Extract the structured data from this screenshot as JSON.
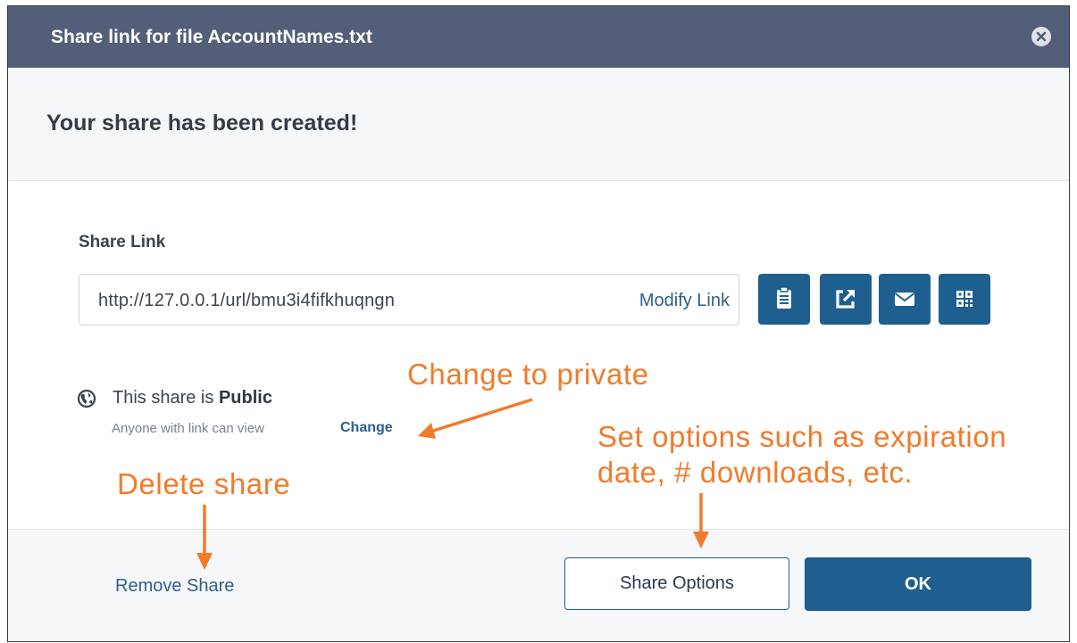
{
  "dialog": {
    "title": "Share link for file AccountNames.txt",
    "banner": "Your share has been created!"
  },
  "share": {
    "label": "Share Link",
    "url": "http://127.0.0.1/url/bmu3i4fifkhuqngn",
    "modify_label": "Modify Link",
    "icons": [
      "clipboard-icon",
      "external-link-icon",
      "email-icon",
      "qr-code-icon"
    ]
  },
  "visibility": {
    "prefix": "This share is",
    "status": "Public",
    "description": "Anyone with link can view",
    "change_label": "Change"
  },
  "footer": {
    "remove_label": "Remove Share",
    "options_label": "Share Options",
    "ok_label": "OK"
  },
  "annotations": {
    "private": "Change to private",
    "delete": "Delete share",
    "options_line1": "Set options such as expiration",
    "options_line2": "date, # downloads, etc."
  },
  "colors": {
    "titlebar": "#535e79",
    "accent": "#1f5f8f",
    "annotation": "#f27a2a"
  }
}
